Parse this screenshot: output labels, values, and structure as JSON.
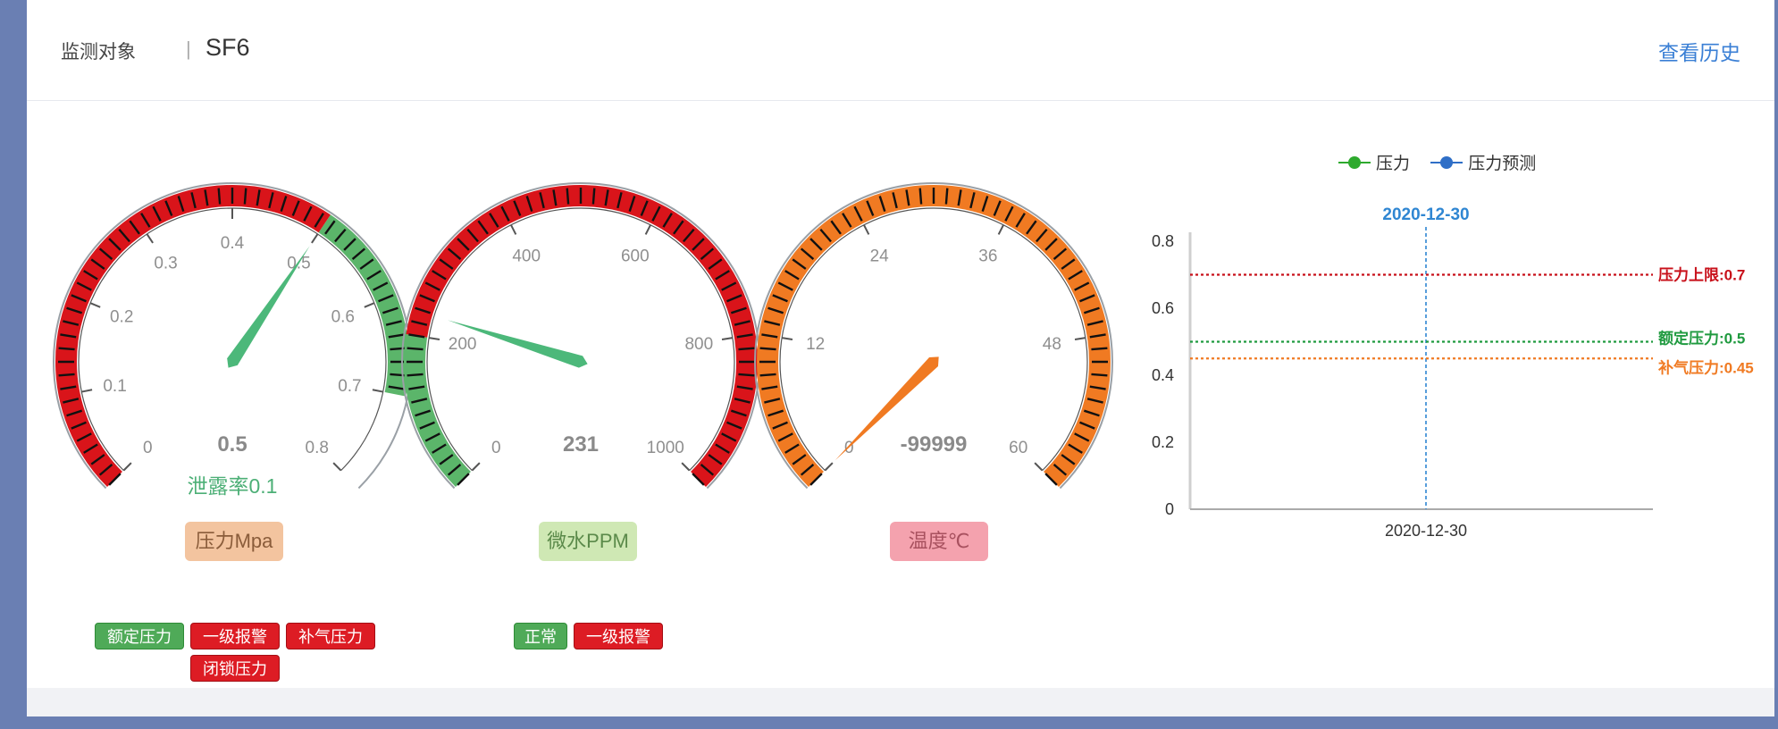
{
  "header": {
    "label": "监测对象",
    "separator": "|",
    "value": "SF6",
    "history_link": "查看历史"
  },
  "gauges": [
    {
      "id": "pressure",
      "min": 0,
      "max": 0.8,
      "value": 0.5,
      "value_text": "0.5",
      "ticks": [
        "0",
        "0.1",
        "0.2",
        "0.3",
        "0.4",
        "0.5",
        "0.6",
        "0.7",
        "0.8"
      ],
      "bands": [
        {
          "to": 0.5,
          "color": "#d9141a"
        },
        {
          "to": 0.7,
          "color": "#5bb56a"
        }
      ],
      "pointer_color": "#4cb87a",
      "extra_text": "泄露率0.1",
      "extra_color": "#4caf76",
      "unit_label": "压力Mpa",
      "unit_bg": "#f3c49f",
      "unit_fg": "#8a5c3a"
    },
    {
      "id": "water",
      "min": 0,
      "max": 1000,
      "value": 231,
      "value_text": "231",
      "ticks": [
        "0",
        "200",
        "400",
        "600",
        "800",
        "1000"
      ],
      "bands": [
        {
          "to": 200,
          "color": "#5bb56a"
        },
        {
          "to": 1000,
          "color": "#d9141a"
        }
      ],
      "pointer_color": "#4cb87a",
      "extra_text": "",
      "unit_label": "微水PPM",
      "unit_bg": "#cfe8b4",
      "unit_fg": "#5b8a4a"
    },
    {
      "id": "temp",
      "min": 0,
      "max": 60,
      "value": -99999,
      "value_text": "-99999",
      "ticks": [
        "0",
        "12",
        "24",
        "36",
        "48",
        "60"
      ],
      "bands": [
        {
          "to": 60,
          "color": "#f07a22"
        }
      ],
      "pointer_color": "#f07a22",
      "extra_text": "",
      "unit_label": "温度℃",
      "unit_bg": "#f4a2ae",
      "unit_fg": "#a8515f"
    }
  ],
  "badges": [
    {
      "text": "额定压力",
      "color": "green"
    },
    {
      "text": "一级报警",
      "color": "red"
    },
    {
      "text": "补气压力",
      "color": "red"
    },
    {
      "text": "闭锁压力",
      "color": "red"
    },
    {
      "text": "正常",
      "color": "green"
    },
    {
      "text": "一级报警",
      "color": "red"
    }
  ],
  "chart_data": {
    "type": "line",
    "title": "",
    "categories": [
      "2020-12-30"
    ],
    "ylim": [
      0,
      0.8
    ],
    "y_ticks": [
      "0",
      "0.2",
      "0.4",
      "0.6",
      "0.8"
    ],
    "series": [
      {
        "name": "压力",
        "color": "#2eaa2e",
        "values": []
      },
      {
        "name": "压力预测",
        "color": "#2f6fc7",
        "values": []
      }
    ],
    "vertical_marker": {
      "label": "2020-12-30",
      "color": "#2f86d2"
    },
    "reference_lines": [
      {
        "label": "压力上限:0.7",
        "value": 0.7,
        "color": "#c8101a"
      },
      {
        "label": "额定压力:0.5",
        "value": 0.5,
        "color": "#1f9a3f"
      },
      {
        "label": "补气压力:0.45",
        "value": 0.45,
        "color": "#f07a22"
      }
    ],
    "grid": false,
    "legend_position": "top"
  }
}
